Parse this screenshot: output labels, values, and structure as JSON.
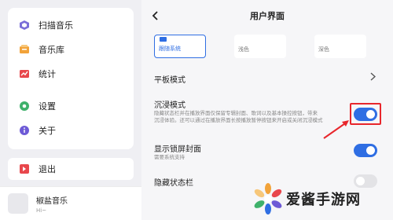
{
  "sidebar": {
    "items": [
      {
        "label": "扫描音乐",
        "icon": "scan-music-icon"
      },
      {
        "label": "音乐库",
        "icon": "music-library-icon"
      },
      {
        "label": "统计",
        "icon": "statistics-icon"
      },
      {
        "label": "设置",
        "icon": "gear-icon"
      },
      {
        "label": "关于",
        "icon": "info-icon"
      }
    ],
    "exit_label": "退出"
  },
  "player": {
    "song_title": "椒盐音乐",
    "song_subtitle": "Hi~"
  },
  "settings": {
    "title": "用户界面",
    "theme_options": [
      {
        "label": "跟随系统",
        "selected": true
      },
      {
        "label": "浅色",
        "selected": false
      },
      {
        "label": "深色",
        "selected": false
      }
    ],
    "tablet_mode": {
      "label": "平板模式"
    },
    "immersive_mode": {
      "label": "沉浸模式",
      "desc_line1": "隐藏状态栏并在播放界面仅保留专辑封面、歌词以及基本操控按钮，带来",
      "desc_line2": "沉浸体验。还可以通过在播放界面长按播放暂停按钮来开启或关闭沉浸模式",
      "enabled": true
    },
    "lockscreen_cover": {
      "label": "显示锁屏封面",
      "desc": "需要系统支持",
      "enabled": true
    },
    "hide_statusbar": {
      "label": "隐藏状态栏",
      "enabled": false
    }
  },
  "colors": {
    "accent": "#2f6ee3",
    "highlight": "#e8262c"
  },
  "watermark": {
    "text": "爱酱手游网"
  }
}
